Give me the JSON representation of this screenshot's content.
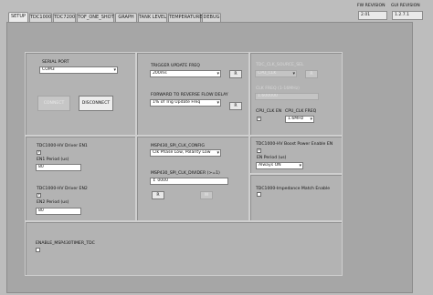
{
  "tabs": [
    {
      "label": "SETUP"
    },
    {
      "label": "TDC1000"
    },
    {
      "label": "TDC7200"
    },
    {
      "label": "TOF_ONE_SHOT"
    },
    {
      "label": "GRAPH"
    },
    {
      "label": "TANK LEVEL"
    },
    {
      "label": "TEMPERATURE"
    },
    {
      "label": "DEBUG"
    }
  ],
  "revisions": {
    "fw_label": "FW REVISION",
    "fw_value": "2.01",
    "gui_label": "GUI REVISION",
    "gui_value": "1.2.7.1"
  },
  "serial": {
    "label": "SERIAL PORT",
    "value": "COM3",
    "connect": "CONNECT",
    "disconnect": "DISCONNECT"
  },
  "trigger": {
    "label": "TRIGGER UPDATE FREQ",
    "value": "200ms",
    "r_button": "R"
  },
  "fwd_rev": {
    "label": "FORWARD TO REVERSE FLOW DELAY",
    "value": "1% of Trig Update Freq",
    "r_button": "R"
  },
  "clk": {
    "source_label": "TDC_CLK_SOURCE_SEL",
    "source_value": "CPU_CLK",
    "freq_label": "CLK FREQ (1-16MHz)",
    "freq_value": "1.600000",
    "cpu_en_label": "CPU_CLK EN",
    "cpu_en_checked": "✓",
    "cpu_freq_label": "CPU_CLK FREQ",
    "cpu_freq_value": "1.6MHz",
    "r_button": "R"
  },
  "driver_en1": {
    "label": "TDC1000-HV Driver EN1",
    "checked": "✓",
    "period_label": "EN1 Period (us)",
    "period_value": "80"
  },
  "driver_en2": {
    "label": "TDC1000-HV Driver EN2",
    "checked": "✓",
    "period_label": "EN2 Period (us)",
    "period_value": "80"
  },
  "spi": {
    "config_label": "MSP430_SPI_CLK_CONFIG",
    "config_value": "Clk Phase Low, Polarity Low",
    "divider_label": "MSP430_SPI_CLK_DIVIDER (>=1)",
    "divider_value": "0000",
    "r_button": "R",
    "w_button": "W"
  },
  "boost": {
    "label": "TDC1000-HV Boost Power Enable EN",
    "checked": "✓",
    "period_label": "EN Period (us)",
    "period_value": "Always ON"
  },
  "impedance": {
    "label": "TDC1000-Impedance Match Enable",
    "checked": ""
  },
  "timer": {
    "label": "ENABLE_MSP430TIMER_TDC",
    "checked": ""
  }
}
